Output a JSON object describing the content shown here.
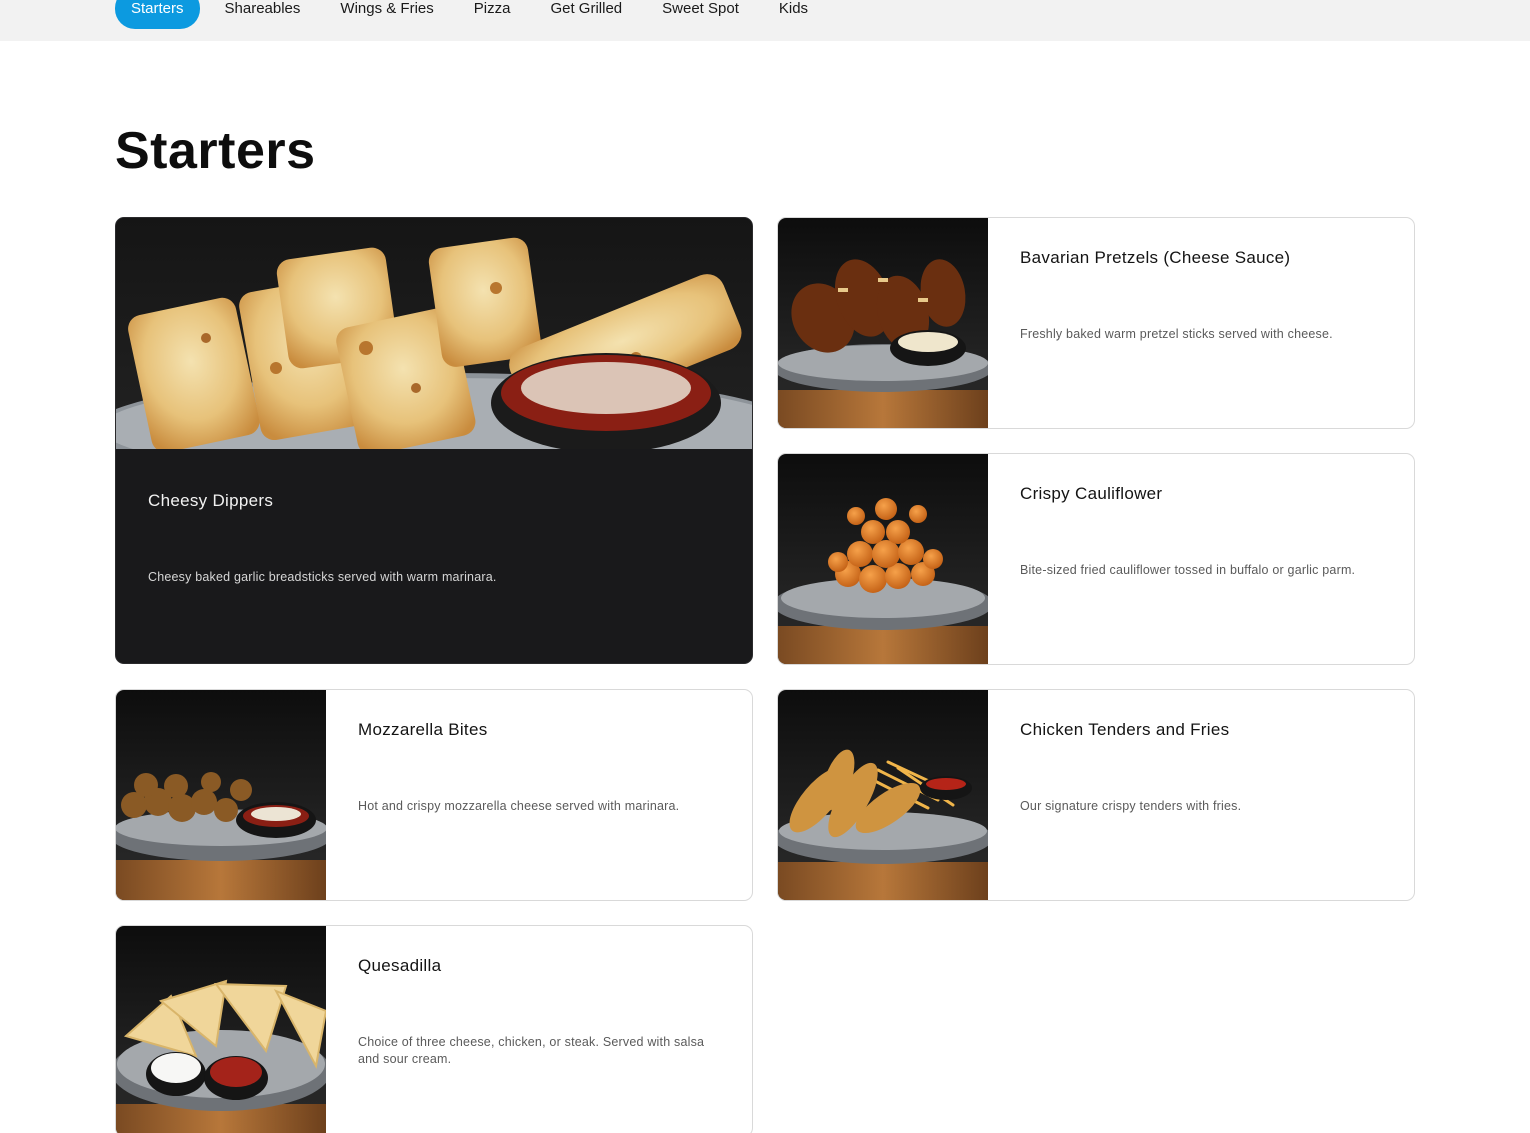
{
  "nav": {
    "tabs": [
      {
        "label": "Starters",
        "active": true
      },
      {
        "label": "Shareables",
        "active": false
      },
      {
        "label": "Wings & Fries",
        "active": false
      },
      {
        "label": "Pizza",
        "active": false
      },
      {
        "label": "Get Grilled",
        "active": false
      },
      {
        "label": "Sweet Spot",
        "active": false
      },
      {
        "label": "Kids",
        "active": false
      }
    ]
  },
  "section": {
    "title": "Starters",
    "items": [
      {
        "name": "Cheesy Dippers",
        "description": "Cheesy baked garlic breadsticks served with warm marinara.",
        "image": "breadsticks-photo"
      },
      {
        "name": "Bavarian Pretzels (Cheese Sauce)",
        "description": "Freshly baked warm pretzel sticks served with cheese.",
        "image": "pretzels-photo"
      },
      {
        "name": "Crispy Cauliflower",
        "description": "Bite-sized fried cauliflower tossed in buffalo or garlic parm.",
        "image": "cauliflower-photo"
      },
      {
        "name": "Mozzarella Bites",
        "description": "Hot and crispy mozzarella cheese served with marinara.",
        "image": "mozzarella-bites-photo"
      },
      {
        "name": "Chicken Tenders and Fries",
        "description": "Our signature crispy tenders with fries.",
        "image": "chicken-tenders-photo"
      },
      {
        "name": "Quesadilla",
        "description": "Choice of three cheese, chicken, or steak. Served with salsa and sour cream.",
        "image": "quesadilla-photo"
      }
    ]
  },
  "colors": {
    "accent": "#0c9ae0",
    "nav_bg": "#f2f2f2",
    "featured_bg": "#19191b"
  }
}
